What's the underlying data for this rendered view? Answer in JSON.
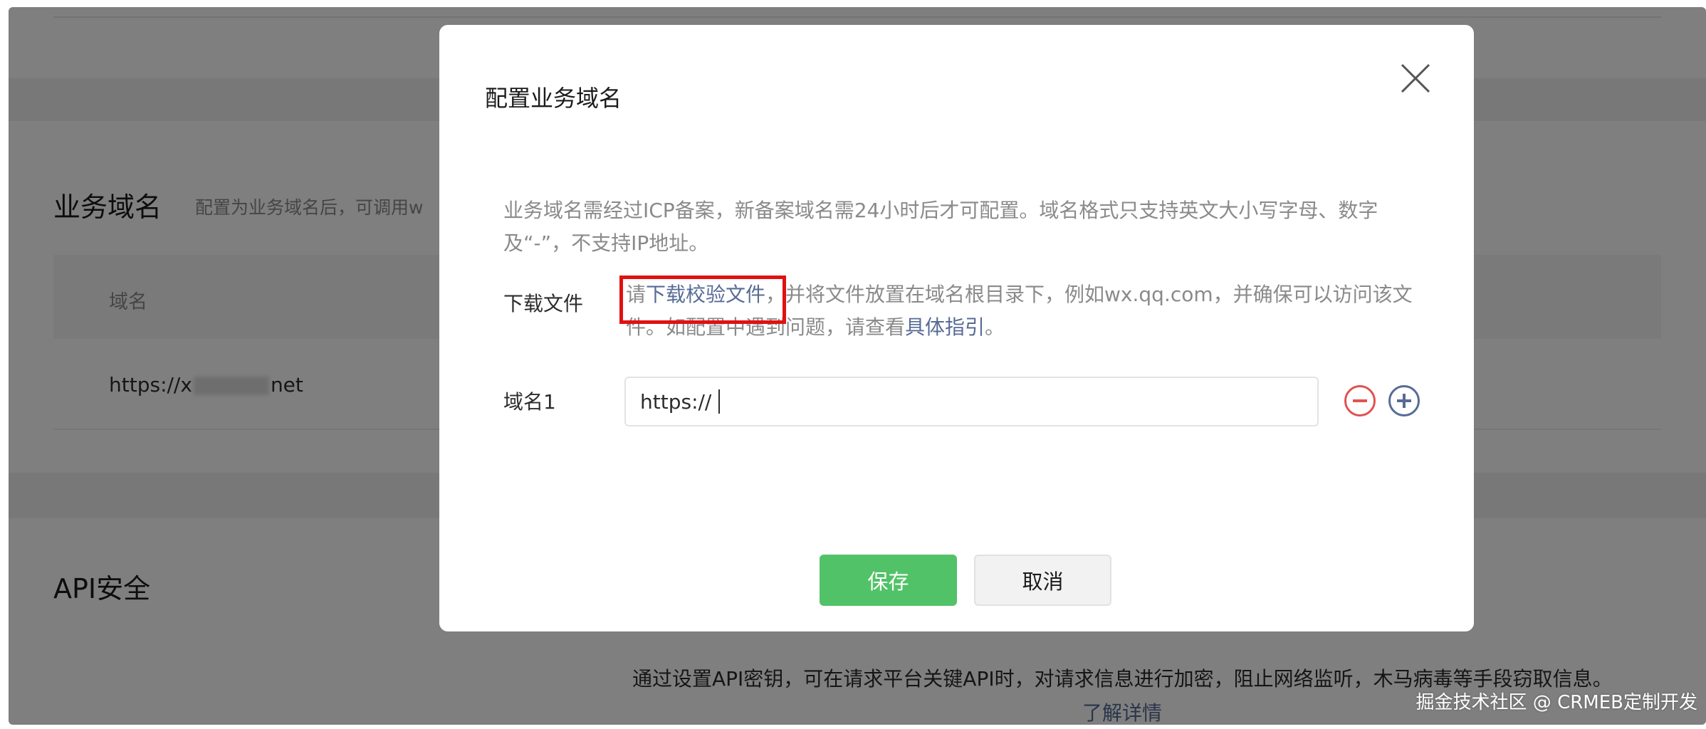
{
  "background": {
    "section_title": "业务域名",
    "section_desc": "配置为业务域名后，可调用w",
    "table_header": "域名",
    "row_domain_prefix": "https://x",
    "row_domain_suffix": "net",
    "api_title": "API安全",
    "api_desc": "通过设置API密钥，可在请求平台关键API时，对请求信息进行加密，阻止网络监听，木马病毒等手段窃取信息。",
    "api_link": "了解详情"
  },
  "watermark": "掘金技术社区 @ CRMEB定制开发",
  "dialog": {
    "title": "配置业务域名",
    "close_icon": "close-icon",
    "notice": "业务域名需经过ICP备案，新备案域名需24小时后才可配置。域名格式只支持英文大小写字母、数字及“-”，不支持IP地址。",
    "download_label": "下载文件",
    "download_prefix": "请",
    "download_link": "下载校验文件",
    "download_middle": "，并将文件放置在域名根目录下，例如wx.qq.com，并确保可以访问该文件。如配置中遇到问题，请查看",
    "guide_link": "具体指引",
    "download_suffix": "。",
    "domain_label": "域名1",
    "domain_value": "https://",
    "save_label": "保存",
    "cancel_label": "取消"
  },
  "colors": {
    "accent_green": "#52c268",
    "link_blue": "#576b95",
    "remove_red": "#e15252",
    "highlight_red": "#e01111"
  }
}
